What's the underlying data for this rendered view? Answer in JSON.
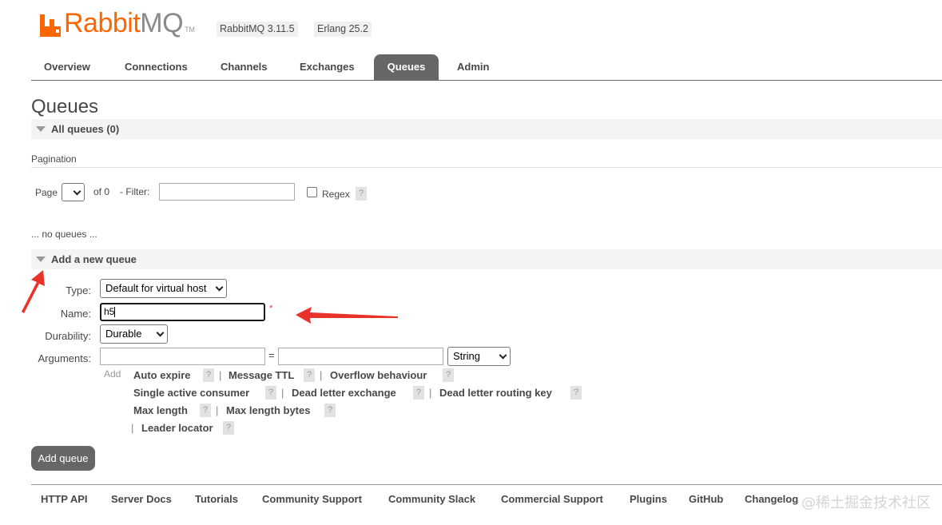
{
  "header": {
    "logo_primary": "Rabbit",
    "logo_secondary": "MQ",
    "logo_tm": "TM",
    "version": "RabbitMQ 3.11.5",
    "erlang": "Erlang 25.2",
    "accent_color": "#ff6600"
  },
  "nav": {
    "tabs": [
      {
        "label": "Overview",
        "active": false
      },
      {
        "label": "Connections",
        "active": false
      },
      {
        "label": "Channels",
        "active": false
      },
      {
        "label": "Exchanges",
        "active": false
      },
      {
        "label": "Queues",
        "active": true
      },
      {
        "label": "Admin",
        "active": false
      }
    ]
  },
  "page": {
    "title": "Queues",
    "all_queues": "All queues (0)",
    "pagination_label": "Pagination",
    "page_label": "Page",
    "of_label": "of 0",
    "filter_label": "- Filter:",
    "filter_value": "",
    "regex_label": "Regex",
    "help_glyph": "?",
    "no_queues": "... no queues ..."
  },
  "add_queue": {
    "section_title": "Add a new queue",
    "type_label": "Type:",
    "type_value": "Default for virtual host",
    "name_label": "Name:",
    "name_value": "h5",
    "required_mark": "*",
    "durability_label": "Durability:",
    "durability_value": "Durable",
    "arguments_label": "Arguments:",
    "equals": "=",
    "arg_type_value": "String",
    "add_label": "Add",
    "arg_links": [
      "Auto expire",
      "Message TTL",
      "Overflow behaviour",
      "Single active consumer",
      "Dead letter exchange",
      "Dead letter routing key",
      "Max length",
      "Max length bytes",
      "Leader locator"
    ],
    "separator": "|",
    "submit_label": "Add queue"
  },
  "footer": {
    "links": [
      "HTTP API",
      "Server Docs",
      "Tutorials",
      "Community Support",
      "Community Slack",
      "Commercial Support",
      "Plugins",
      "GitHub",
      "Changelog"
    ]
  },
  "watermark": "@稀土掘金技术社区",
  "annotation_color": "#e8322a"
}
